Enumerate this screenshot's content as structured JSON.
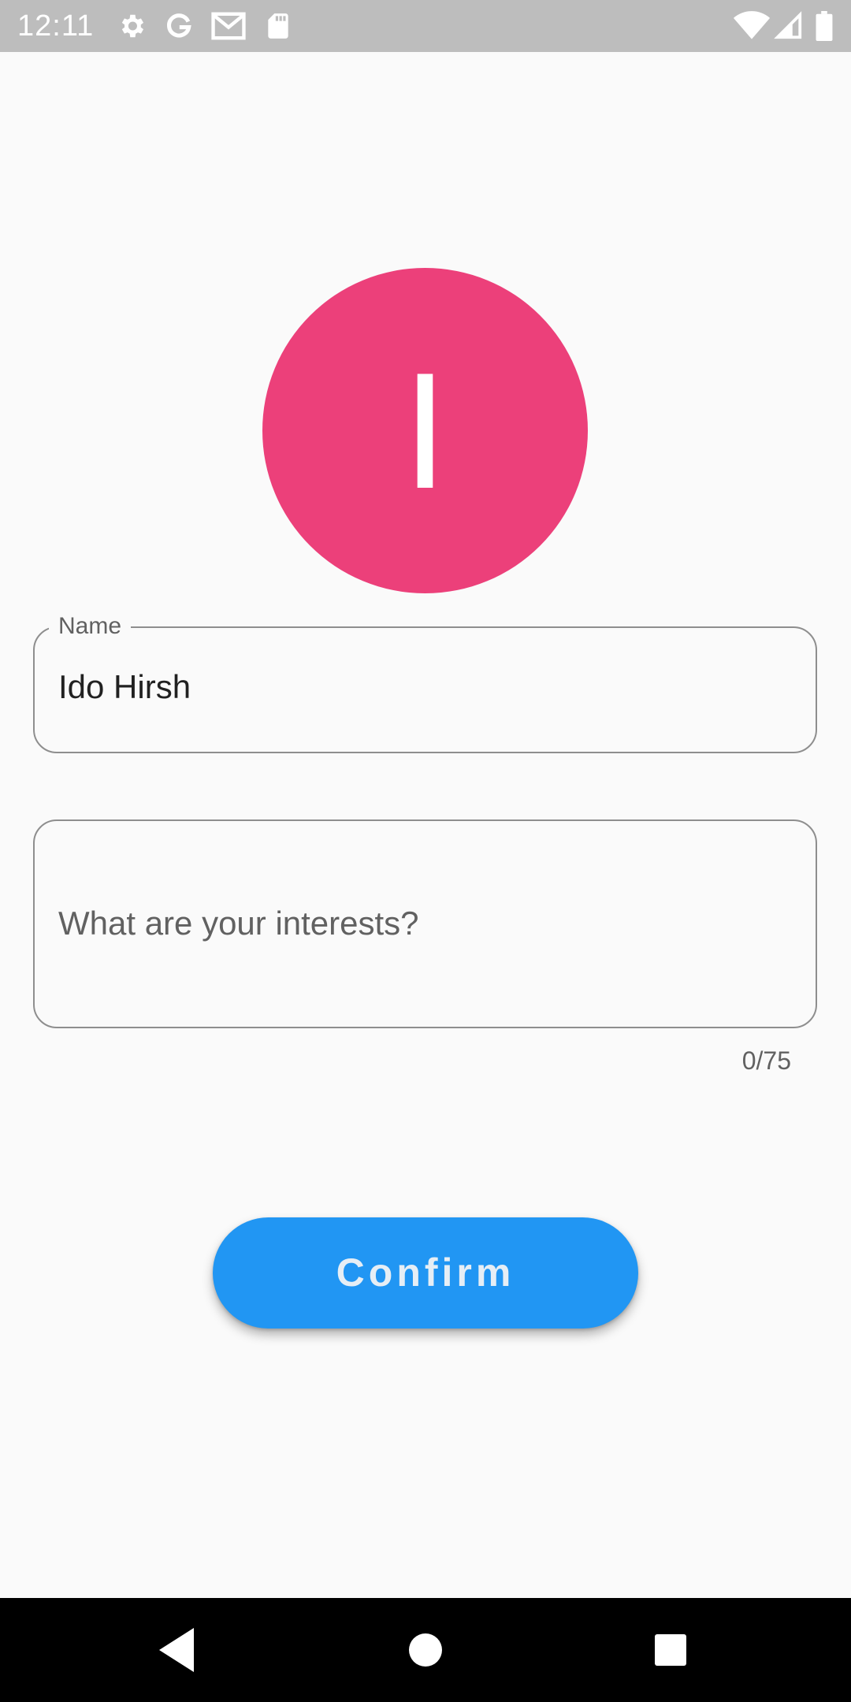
{
  "status_bar": {
    "time": "12:11",
    "left_icons": [
      "gear-icon",
      "google-icon",
      "gmail-icon",
      "sd-card-icon"
    ],
    "right_icons": [
      "wifi-icon",
      "cell-signal-icon",
      "battery-icon"
    ]
  },
  "avatar": {
    "letter": "I",
    "color": "#ec407a"
  },
  "name_field": {
    "label": "Name",
    "value": "Ido Hirsh"
  },
  "interests_field": {
    "placeholder": "What are your interests?",
    "counter": "0/75"
  },
  "confirm_button": {
    "label": "Confirm",
    "color": "#2196f3"
  },
  "nav_bar": {
    "buttons": [
      "back-icon",
      "home-icon",
      "recents-icon"
    ]
  }
}
